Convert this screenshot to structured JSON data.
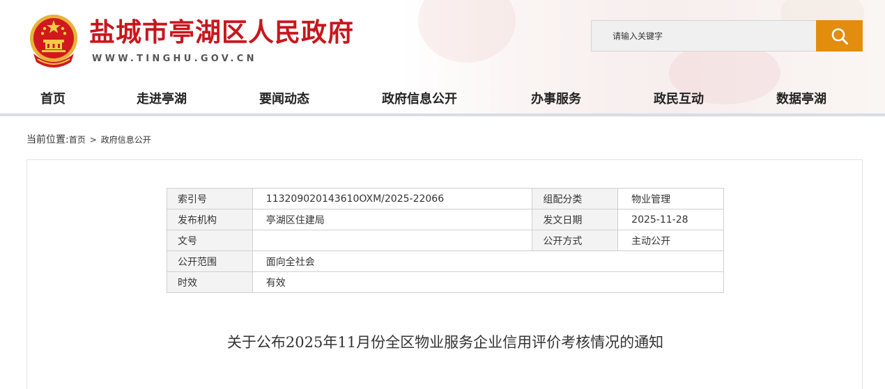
{
  "header": {
    "site_title": "盐城市亭湖区人民政府",
    "site_url": "WWW.TINGHU.GOV.CN",
    "search_placeholder": "请输入关键字",
    "search_icon": "search-icon",
    "emblem_icon": "national-emblem-icon"
  },
  "nav": {
    "items": [
      {
        "label": "首页"
      },
      {
        "label": "走进亭湖"
      },
      {
        "label": "要闻动态"
      },
      {
        "label": "政府信息公开"
      },
      {
        "label": "办事服务"
      },
      {
        "label": "政民互动"
      },
      {
        "label": "数据亭湖"
      }
    ]
  },
  "breadcrumb": {
    "prefix": "当前位置:",
    "home": "首页",
    "separator": ">",
    "current": "政府信息公开"
  },
  "meta_table": {
    "index_label": "索引号",
    "index_value": "113209020143610OXM/2025-22066",
    "category_label": "组配分类",
    "category_value": "物业管理",
    "publisher_label": "发布机构",
    "publisher_value": "亭湖区住建局",
    "date_label": "发文日期",
    "date_value": "2025-11-28",
    "doc_no_label": "文号",
    "doc_no_value": "",
    "method_label": "公开方式",
    "method_value": "主动公开",
    "scope_label": "公开范围",
    "scope_value": "面向全社会",
    "validity_label": "时效",
    "validity_value": "有效"
  },
  "article": {
    "title": "关于公布2025年11月份全区物业服务企业信用评价考核情况的通知"
  },
  "colors": {
    "brand_red": "#c8161d",
    "search_orange": "#e28d0e",
    "nav_rule": "#d6dde6"
  }
}
